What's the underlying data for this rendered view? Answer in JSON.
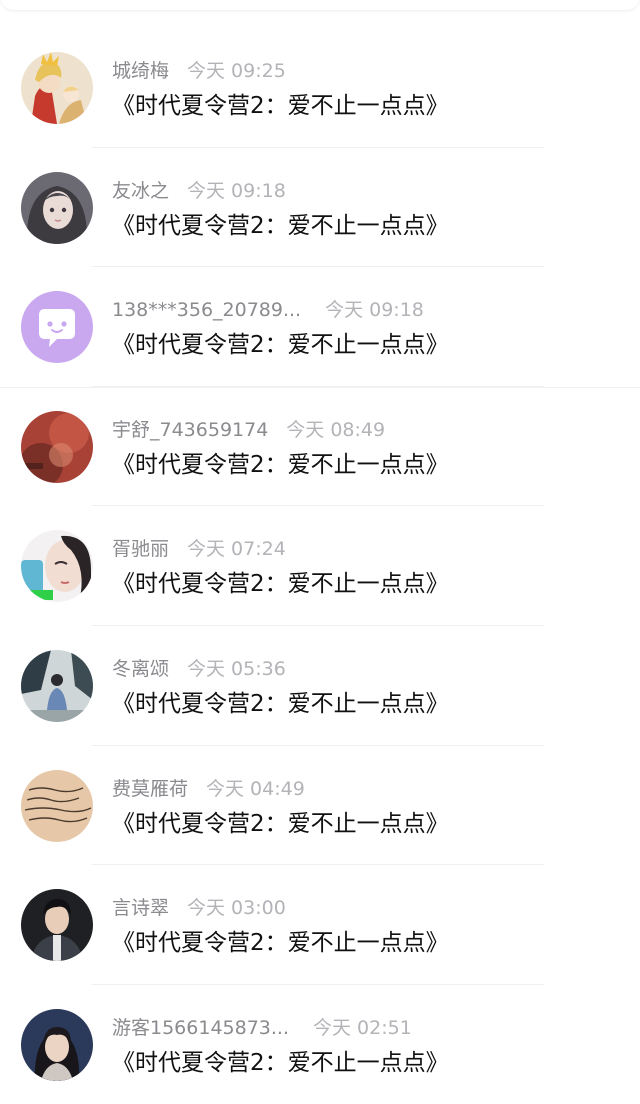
{
  "messages": [
    {
      "name": "城绮梅",
      "time": "今天 09:25",
      "text": "《时代夏令营2：爱不止一点点》",
      "avatar": "anime-girl-avatar"
    },
    {
      "name": "友冰之",
      "time": "今天 09:18",
      "text": "《时代夏令营2：爱不止一点点》",
      "avatar": "dark-hair-girl-avatar"
    },
    {
      "name": "138***356_20789...",
      "time": "今天 09:18",
      "text": "《时代夏令营2：爱不止一点点》",
      "avatar": "default-chat-avatar"
    },
    {
      "name": "宇舒_743659174",
      "time": "今天 08:49",
      "text": "《时代夏令营2：爱不止一点点》",
      "avatar": "red-blur-avatar"
    },
    {
      "name": "胥驰丽",
      "time": "今天 07:24",
      "text": "《时代夏令营2：爱不止一点点》",
      "avatar": "face-photo-avatar"
    },
    {
      "name": "冬离颂",
      "time": "今天 05:36",
      "text": "《时代夏令营2：爱不止一点点》",
      "avatar": "forest-person-avatar"
    },
    {
      "name": "费莫雁荷",
      "time": "今天 04:49",
      "text": "《时代夏令营2：爱不止一点点》",
      "avatar": "handwriting-avatar"
    },
    {
      "name": "言诗翠",
      "time": "今天 03:00",
      "text": "《时代夏令营2：爱不止一点点》",
      "avatar": "man-portrait-avatar"
    },
    {
      "name": "游客1566145873...",
      "time": "今天 02:51",
      "text": "《时代夏令营2：爱不止一点点》",
      "avatar": "woman-portrait-avatar"
    }
  ],
  "colors": {
    "name": "#8a8a8f",
    "time": "#b3b3b8",
    "message": "#111111",
    "default_avatar": "#c9a8f0"
  }
}
